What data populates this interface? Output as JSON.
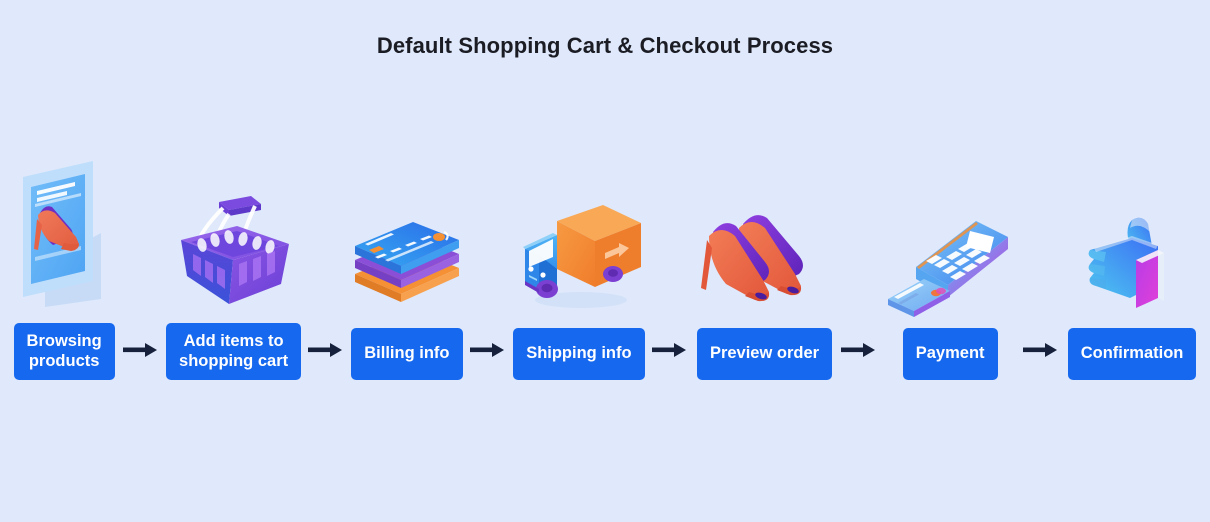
{
  "page": {
    "background_color": "#dfe9fb",
    "title": "Default Shopping Cart & Checkout Process",
    "title_color": "#1b1c24"
  },
  "theme": {
    "box_fill": "#1668ef",
    "box_text": "#ffffff",
    "arrow_color": "#17213c"
  },
  "flow": {
    "steps": [
      {
        "id": "browsing-products",
        "label": "Browsing\nproducts",
        "icon": "monitor-shoe-icon",
        "icon_description": "isometric computer screen displaying a high-heel shoe",
        "colors": {
          "screen": "#61b4f7",
          "frame": "#bcdcfb",
          "shoe_body": "#ec6c4a",
          "shoe_accent": "#6d2fc4"
        }
      },
      {
        "id": "add-items-to-shopping-cart",
        "label": "Add items to\nshopping cart",
        "icon": "shopping-basket-icon",
        "icon_description": "isometric purple and blue shopping basket with handles",
        "colors": {
          "basket_top": "#8a5ae0",
          "basket_front": "#3b52d9",
          "handle": "#ffffff"
        }
      },
      {
        "id": "billing-info",
        "label": "Billing info",
        "icon": "credit-cards-stack-icon",
        "icon_description": "stack of three credit cards, blue on top, purple and orange beneath",
        "colors": {
          "card_top": "#2f9bf0",
          "card_mid": "#8a4fd6",
          "card_bottom": "#f59034"
        }
      },
      {
        "id": "shipping-info",
        "label": "Shipping info",
        "icon": "delivery-truck-icon",
        "icon_description": "isometric delivery truck with blue cab and orange cargo box bearing an arrow",
        "colors": {
          "cab": "#3ea8f0",
          "cargo": "#f5883a",
          "wheels": "#7b3fd1"
        }
      },
      {
        "id": "preview-order",
        "label": "Preview order",
        "icon": "high-heel-shoes-pair-icon",
        "icon_description": "pair of orange and purple high-heel shoes",
        "colors": {
          "shoe_body": "#ec6c4a",
          "shoe_accent": "#6d2fc4"
        }
      },
      {
        "id": "payment",
        "label": "Payment",
        "icon": "card-payment-terminal-icon",
        "icon_description": "isometric POS card terminal with keypad, screen and a bank card",
        "colors": {
          "terminal": "#5aa9f2",
          "terminal_edge": "#c045e0",
          "card": "#7ec4f5"
        }
      },
      {
        "id": "confirmation",
        "label": "Confirmation",
        "icon": "thumbs-up-icon",
        "icon_description": "thumbs-up hand with blue to magenta gradient",
        "colors": {
          "hand_start": "#4ec8f0",
          "hand_end": "#3b6ef5",
          "cuff": "#d23de0"
        }
      }
    ],
    "connectors": [
      {
        "id": "arrow-1",
        "icon": "arrow-right-icon"
      },
      {
        "id": "arrow-2",
        "icon": "arrow-right-icon"
      },
      {
        "id": "arrow-3",
        "icon": "arrow-right-icon"
      },
      {
        "id": "arrow-4",
        "icon": "arrow-right-icon"
      },
      {
        "id": "arrow-5",
        "icon": "arrow-right-icon"
      },
      {
        "id": "arrow-6",
        "icon": "arrow-right-icon"
      }
    ]
  }
}
